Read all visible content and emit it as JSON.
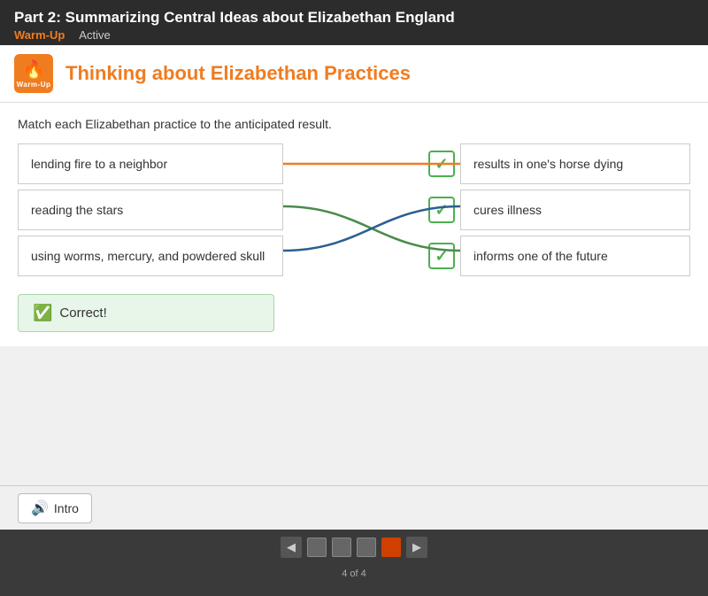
{
  "topBar": {
    "title": "Part 2: Summarizing Central Ideas about Elizabethan England",
    "label": "Warm-Up",
    "status": "Active"
  },
  "card": {
    "headerIconLabel": "Warm-Up",
    "headerTitle": "Thinking about Elizabethan Practices",
    "instructions": "Match each Elizabethan practice to the anticipated result."
  },
  "leftItems": [
    {
      "id": "l1",
      "text": "lending fire to a neighbor"
    },
    {
      "id": "l2",
      "text": "reading the stars"
    },
    {
      "id": "l3",
      "text": "using worms, mercury, and powdered skull"
    }
  ],
  "rightItems": [
    {
      "id": "r1",
      "text": "results in one's horse dying"
    },
    {
      "id": "r2",
      "text": "cures illness"
    },
    {
      "id": "r3",
      "text": "informs one of the future"
    }
  ],
  "correctBanner": {
    "text": "Correct!"
  },
  "introButton": {
    "label": "Intro"
  },
  "pagination": {
    "pages": 4,
    "current": 4,
    "pageCountText": "4 of 4"
  },
  "connections": [
    {
      "from": 0,
      "to": 0,
      "color": "#f07c20"
    },
    {
      "from": 1,
      "to": 2,
      "color": "#4a8c4a"
    },
    {
      "from": 2,
      "to": 1,
      "color": "#2a6090"
    }
  ]
}
